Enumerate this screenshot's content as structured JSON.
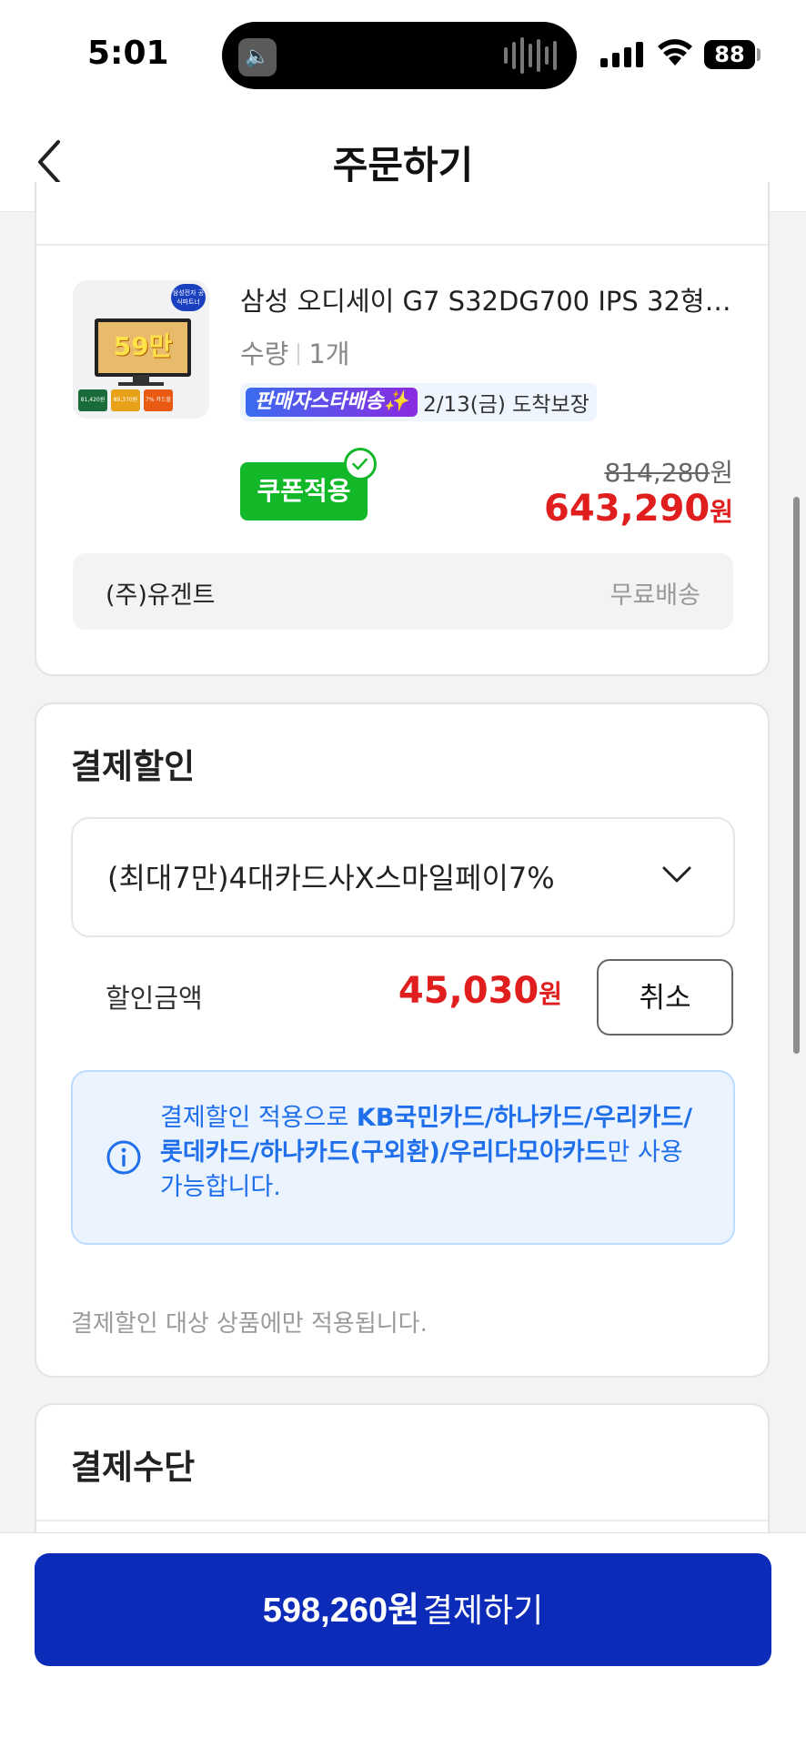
{
  "status": {
    "time": "5:01",
    "battery": "88"
  },
  "header": {
    "title": "주문하기",
    "back_icon": "chevron-left-icon"
  },
  "product": {
    "name": "삼성 오디세이 G7 S32DG700 IPS 32형…",
    "qty_label": "수량",
    "qty_value": "1개",
    "thumb": {
      "badge": "삼성전자 공식파트너",
      "promo": "59만",
      "chips": [
        "81,420원 즉시할인",
        "89,370원 쿠폰할인",
        "7% 카드할인"
      ]
    },
    "delivery_tag": "판매자스타배송✨",
    "delivery_text": "2/13(금) 도착보장",
    "coupon_label": "쿠폰적용",
    "original_price": "814,280",
    "original_unit": "원",
    "final_price": "643,290",
    "final_unit": "원",
    "seller": "(주)유겐트",
    "shipping": "무료배송"
  },
  "payment_discount": {
    "title": "결제할인",
    "selected_option": "(최대7만)4대카드사X스마일페이7%",
    "amount_label": "할인금액",
    "amount": "45,030",
    "amount_unit": "원",
    "cancel_label": "취소",
    "info_prefix": "결제할인 적용으로 ",
    "info_cards": "KB국민카드/하나카드/우리카드/롯데카드/하나카드(구외환)/우리다모아카드",
    "info_suffix": "만 사용 가능합니다.",
    "note": "결제할인 대상 상품에만 적용됩니다."
  },
  "payment_method": {
    "title": "결제수단"
  },
  "checkout": {
    "amount": "598,260원",
    "label": "결제하기"
  },
  "colors": {
    "accent_blue": "#0b2bb8",
    "price_red": "#e01e1e",
    "coupon_green": "#12b827",
    "info_blue": "#1f6feb"
  }
}
